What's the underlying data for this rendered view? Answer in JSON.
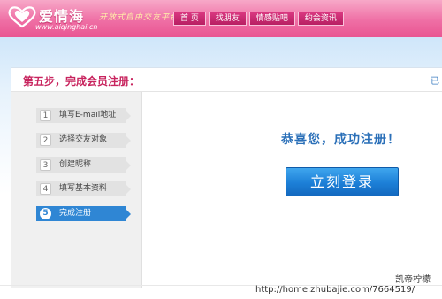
{
  "header": {
    "logo_text": "爱情海",
    "logo_url": "www.aiqinghai.cn",
    "slogan": "开放式自由交友平台",
    "nav": [
      "首 页",
      "找朋友",
      "情感贴吧",
      "约会资讯"
    ],
    "colors": {
      "header_pink": "#e95592",
      "title_red": "#c8245e",
      "accent_blue": "#2f86d4"
    }
  },
  "page": {
    "step_title": "第五步，完成会员注册：",
    "corner_text": "已",
    "steps": [
      {
        "num": "1",
        "label": "填写E-mail地址"
      },
      {
        "num": "2",
        "label": "选择交友对象"
      },
      {
        "num": "3",
        "label": "创建昵称"
      },
      {
        "num": "4",
        "label": "填写基本资料"
      },
      {
        "num": "5",
        "label": "完成注册"
      }
    ],
    "active_step": "5",
    "success_message": "恭喜您，成功注册！",
    "login_button": "立刻登录"
  },
  "watermark": {
    "line1": "凯帝柠檬",
    "line2": "http://home.zhubajie.com/7664519/"
  }
}
